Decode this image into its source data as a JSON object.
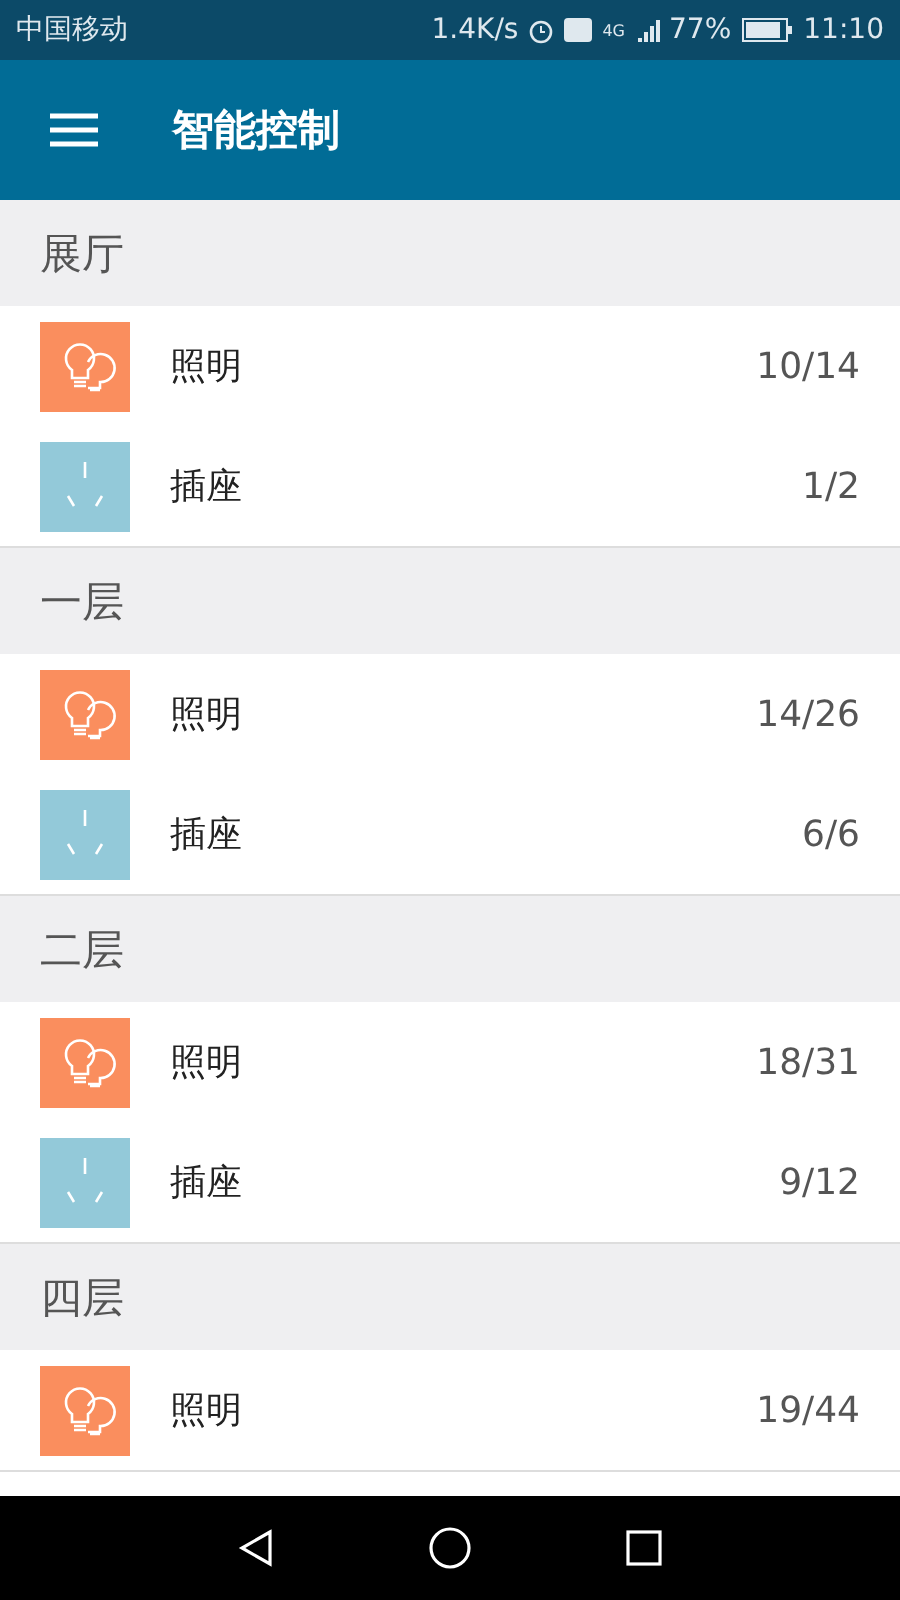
{
  "status_bar": {
    "carrier": "中国移动",
    "speed": "1.4K/s",
    "network": "4G",
    "battery": "77%",
    "time": "11:10"
  },
  "app_bar": {
    "title": "智能控制"
  },
  "sections": [
    {
      "title": "展厅",
      "items": [
        {
          "kind": "light",
          "label": "照明",
          "count": "10/14"
        },
        {
          "kind": "socket",
          "label": "插座",
          "count": "1/2"
        }
      ]
    },
    {
      "title": "一层",
      "items": [
        {
          "kind": "light",
          "label": "照明",
          "count": "14/26"
        },
        {
          "kind": "socket",
          "label": "插座",
          "count": "6/6"
        }
      ]
    },
    {
      "title": "二层",
      "items": [
        {
          "kind": "light",
          "label": "照明",
          "count": "18/31"
        },
        {
          "kind": "socket",
          "label": "插座",
          "count": "9/12"
        }
      ]
    },
    {
      "title": "四层",
      "items": [
        {
          "kind": "light",
          "label": "照明",
          "count": "19/44"
        }
      ]
    }
  ]
}
